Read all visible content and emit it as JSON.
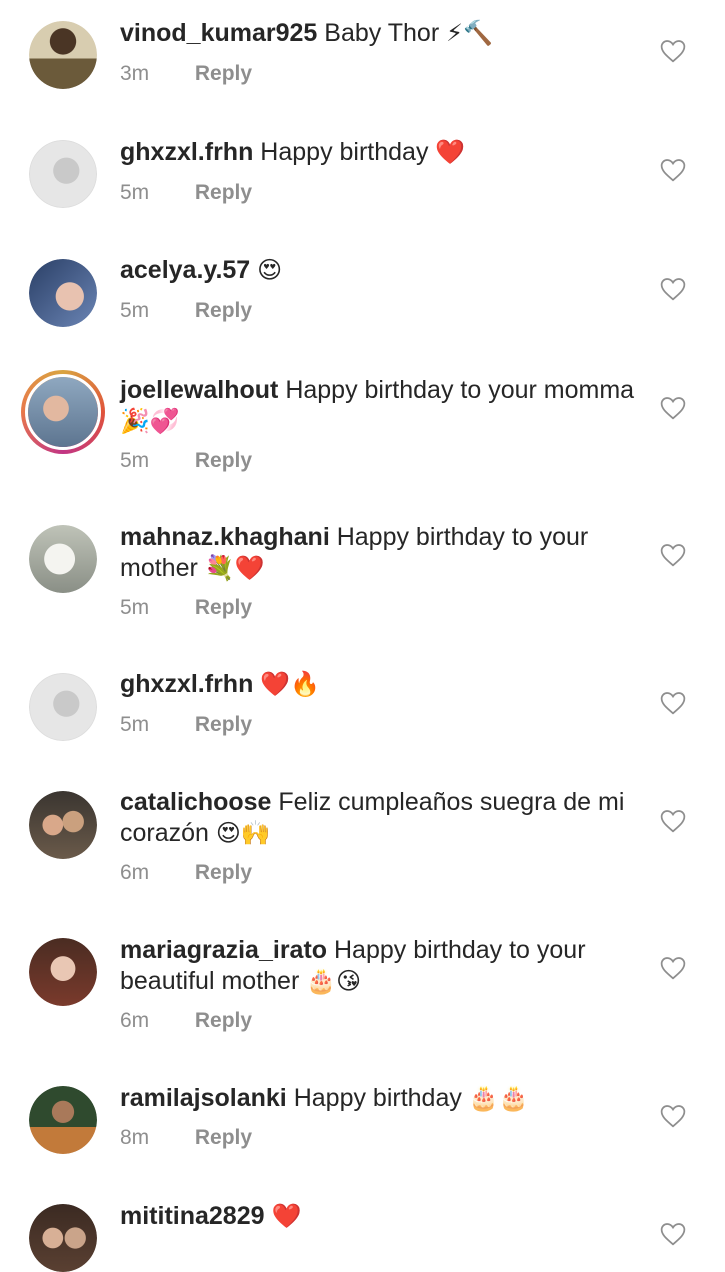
{
  "comments": [
    {
      "username": "vinod_kumar925",
      "text": "Baby Thor",
      "emoji": "⚡🔨",
      "time": "3m",
      "reply": "Reply"
    },
    {
      "username": "ghxzxl.frhn",
      "text": "Happy birthday",
      "emoji": "❤️",
      "time": "5m",
      "reply": "Reply"
    },
    {
      "username": "acelya.y.57",
      "text": "",
      "emoji": "😍",
      "time": "5m",
      "reply": "Reply"
    },
    {
      "username": "joellewalhout",
      "text": "Happy birthday to your momma",
      "emoji": "🎉💞",
      "time": "5m",
      "reply": "Reply"
    },
    {
      "username": "mahnaz.khaghani",
      "text": "Happy birthday to your mother",
      "emoji": "💐❤️",
      "time": "5m",
      "reply": "Reply"
    },
    {
      "username": "ghxzxl.frhn",
      "text": "",
      "emoji": "❤️🔥",
      "time": "5m",
      "reply": "Reply"
    },
    {
      "username": "catalichoose",
      "text": "Feliz cumpleaños suegra de mi corazón",
      "emoji": "😍🙌",
      "time": "6m",
      "reply": "Reply"
    },
    {
      "username": "mariagrazia_irato",
      "text": "Happy birthday to your beautiful mother",
      "emoji": "🎂😘",
      "time": "6m",
      "reply": "Reply"
    },
    {
      "username": "ramilajsolanki",
      "text": "Happy birthday",
      "emoji": "🎂🎂",
      "time": "8m",
      "reply": "Reply"
    },
    {
      "username": "mititina2829",
      "text": "",
      "emoji": "❤️",
      "time": "",
      "reply": ""
    }
  ],
  "icons": {
    "like": "heart-outline-icon"
  },
  "colors": {
    "text": "#262626",
    "secondary": "#8e8e8e",
    "background": "#ffffff"
  }
}
